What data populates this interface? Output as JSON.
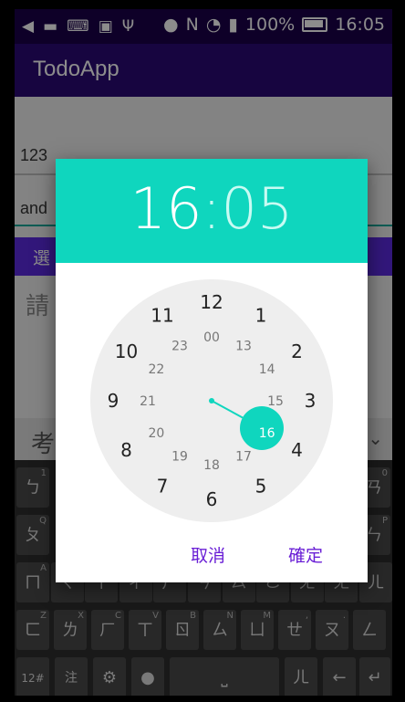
{
  "status_bar": {
    "battery": "100%",
    "time": "16:05"
  },
  "app": {
    "title": "TodoApp"
  },
  "form": {
    "field1_value": "123",
    "field2_value": "and",
    "select_button_label": "選",
    "hint_text": "請"
  },
  "keyboard": {
    "suggestion_left": "考",
    "row1": [
      {
        "main": "ㄅ",
        "sub": "1"
      },
      {
        "main": "ㄢ",
        "sub": "0"
      }
    ],
    "row2": [
      {
        "main": "ㄆ",
        "sub": "Q"
      },
      {
        "main": "ㄣ",
        "sub": "P"
      }
    ],
    "row3": [
      {
        "main": "ㄇ",
        "sub": "A"
      },
      {
        "main": "ㄑ",
        "sub": ""
      },
      {
        "main": "ㄒ",
        "sub": ""
      },
      {
        "main": "ㄔ",
        "sub": ""
      },
      {
        "main": "ㄕ",
        "sub": ""
      },
      {
        "main": "ㄘ",
        "sub": ""
      },
      {
        "main": "ㄙ",
        "sub": ""
      },
      {
        "main": "ㄜ",
        "sub": ""
      },
      {
        "main": "ㄤ",
        "sub": ""
      },
      {
        "main": "ㄤ",
        "sub": ""
      },
      {
        "main": "ㄦ",
        "sub": ""
      }
    ],
    "row4": [
      {
        "main": "ㄈ",
        "sub": "Z"
      },
      {
        "main": "ㄌ",
        "sub": "X"
      },
      {
        "main": "ㄏ",
        "sub": "C"
      },
      {
        "main": "ㄒ",
        "sub": "V"
      },
      {
        "main": "ㄖ",
        "sub": "B"
      },
      {
        "main": "ㄙ",
        "sub": "N"
      },
      {
        "main": "ㄩ",
        "sub": "M"
      },
      {
        "main": "ㄝ",
        "sub": ","
      },
      {
        "main": "ㄡ",
        "sub": "."
      },
      {
        "main": "ㄥ",
        "sub": ""
      }
    ],
    "bottom": {
      "k12": "12#",
      "zhu": "注",
      "mic": "🎤",
      "er": "ㄦ"
    }
  },
  "dialog": {
    "hour": "16",
    "separator": ":",
    "minute": "05",
    "cancel_label": "取消",
    "ok_label": "確定",
    "outer_hours": [
      "12",
      "1",
      "2",
      "3",
      "4",
      "5",
      "6",
      "7",
      "8",
      "9",
      "10",
      "11"
    ],
    "inner_hours": [
      "00",
      "13",
      "14",
      "15",
      "16",
      "17",
      "18",
      "19",
      "20",
      "21",
      "22",
      "23"
    ],
    "selected_hour": "16",
    "colors": {
      "accent": "#0fd6be",
      "button_text": "#6a1fd6",
      "clock_face": "#eeeeee"
    }
  }
}
